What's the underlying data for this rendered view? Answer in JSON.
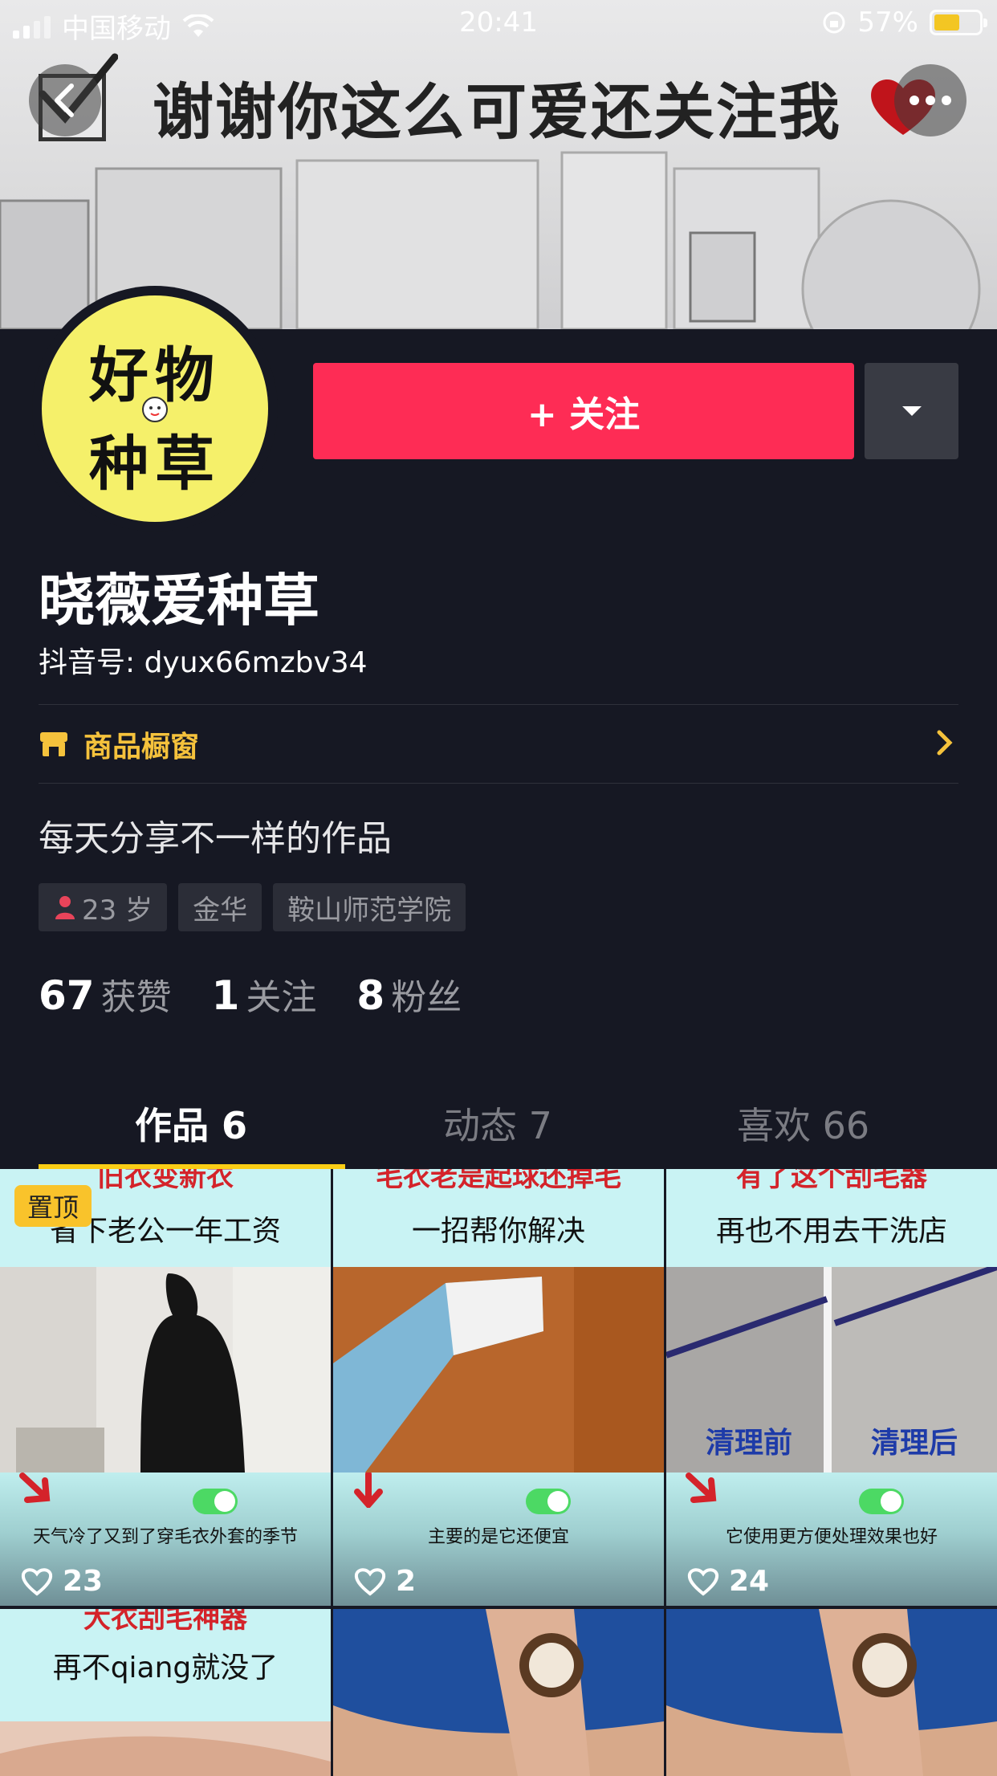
{
  "status_bar": {
    "carrier": "中国移动",
    "time": "20:41",
    "battery": "57%",
    "battery_level": 0.57
  },
  "cover": {
    "caption": "谢谢你这么可爱还关注我"
  },
  "profile": {
    "avatar_text_line1": "好物",
    "avatar_text_line2": "种草",
    "follow_label": "+ 关注",
    "username": "晓薇爱种草",
    "douyin_id": "抖音号: dyux66mzbv34",
    "shop_label": "商品橱窗",
    "bio": "每天分享不一样的作品",
    "tags": {
      "age": "23 岁",
      "city": "金华",
      "school": "鞍山师范学院"
    },
    "stats": {
      "likes_num": "67",
      "likes_label": "获赞",
      "following_num": "1",
      "following_label": "关注",
      "followers_num": "8",
      "followers_label": "粉丝"
    }
  },
  "tabs": {
    "works": "作品 6",
    "moments": "动态 7",
    "likes": "喜欢 66",
    "active": "works"
  },
  "grid": {
    "tiles": [
      {
        "top_red": "旧衣变新衣",
        "title": "省下老公一年工资",
        "subtitle": "天气冷了又到了穿毛衣外套的季节",
        "likes": "23",
        "pinned_label": "置顶"
      },
      {
        "top_red": "毛衣老是起球还掉毛",
        "title": "一招帮你解决",
        "subtitle": "主要的是它还便宜",
        "likes": "2"
      },
      {
        "top_red": "有了这个刮毛器",
        "title": "再也不用去干洗店",
        "subtitle": "它使用更方便处理效果也好",
        "likes": "24",
        "before_label": "清理前",
        "after_label": "清理后"
      },
      {
        "top_red": "大衣刮毛神器",
        "title": "再不qiang就没了"
      },
      {},
      {}
    ]
  },
  "colors": {
    "background": "#161823",
    "follow_red": "#fe2c55",
    "accent_yellow": "#face15",
    "shop_gold": "#f5c23c"
  },
  "icons": {
    "back": "chevron-left-icon",
    "more": "more-dots-icon",
    "dropdown": "caret-down-icon",
    "shop": "shop-icon",
    "chevron_right": "chevron-right-icon",
    "gender": "female-icon",
    "heart": "heart-outline-icon"
  }
}
